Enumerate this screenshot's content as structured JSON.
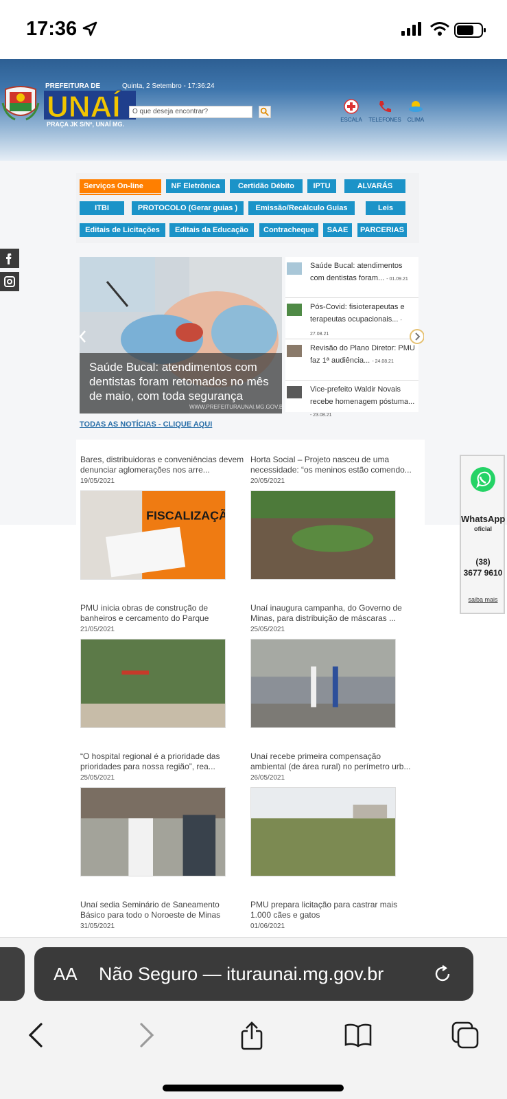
{
  "status_bar": {
    "time": "17:36"
  },
  "header": {
    "logo_prefix": "PREFEITURA DE",
    "logo_name": "UNAÍ",
    "address": "PRAÇA JK S/Nº, UNAÍ MG.",
    "date_line": "Quinta, 2 Setembro - 17:36:24",
    "search_placeholder": "O que deseja encontrar?",
    "tools": [
      {
        "label": "ESCALA",
        "icon": "medical-cross-icon"
      },
      {
        "label": "TELEFONES",
        "icon": "phone-icon"
      },
      {
        "label": "CLIMA",
        "icon": "weather-sun-cloud-icon"
      }
    ]
  },
  "services": [
    "Serviços On-line",
    "NF Eletrônica",
    "Certidão Débito",
    "IPTU",
    "ALVARÁS",
    "ITBI",
    "PROTOCOLO (Gerar guias )",
    "Emissão/Recálculo Guias",
    "Leis",
    "Editais de Licitações",
    "Editais da Educação",
    "Contracheque",
    "SAAE",
    "PARCERIAS"
  ],
  "slider": {
    "caption": "Saúde Bucal: atendimentos com dentistas foram retomados no mês de maio, com toda segurança",
    "watermark": "WWW.PREFEITURAUNAI.MG.GOV.BR"
  },
  "news_list": [
    {
      "title": "Saúde Bucal: atendimentos com dentistas foram...",
      "date": "- 01.09.21"
    },
    {
      "title": "Pós-Covid: fisioterapeutas e terapeutas ocupacionais...",
      "date": "- 27.08.21"
    },
    {
      "title": "Revisão do Plano Diretor: PMU faz 1ª audiência...",
      "date": "- 24.08.21"
    },
    {
      "title": "Vice-prefeito Waldir Novais recebe homenagem póstuma...",
      "date": "- 23.08.21"
    }
  ],
  "all_news_link": "TODAS AS NOTÍCIAS - CLIQUE AQUI",
  "cards": [
    {
      "title": "Bares, distribuidoras e conveniências devem denunciar aglomerações nos arre...",
      "date": "19/05/2021"
    },
    {
      "title": "Horta Social – Projeto nasceu de uma necessidade: “os meninos estão comendo...",
      "date": "20/05/2021"
    },
    {
      "title": "PMU inicia obras de construção de banheiros e cercamento do Parque Dujardes...",
      "date": "21/05/2021"
    },
    {
      "title": "Unaí inaugura campanha, do Governo de Minas, para distribuição de máscaras ...",
      "date": "25/05/2021"
    },
    {
      "title": "“O hospital regional é a prioridade das prioridades para nossa região”, rea...",
      "date": "25/05/2021"
    },
    {
      "title": "Unaí recebe primeira compensação ambiental (de área rural) no perímetro urb...",
      "date": "26/05/2021"
    },
    {
      "title": "Unaí sedia Seminário de Saneamento Básico para todo o Noroeste de Minas",
      "date": "31/05/2021"
    },
    {
      "title": "PMU prepara licitação para castrar mais 1.000 cães e gatos",
      "date": "01/06/2021"
    }
  ],
  "whatsapp": {
    "title": "WhatsApp",
    "subtitle": "oficial",
    "phone_line1": "(38)",
    "phone_line2": "3677 9610",
    "more": "saiba mais"
  },
  "safari": {
    "aa": "AA",
    "url_text": "Não Seguro — ituraunai.mg.gov.br"
  },
  "colors": {
    "service_blue": "#1b93c8",
    "service_active": "#ff7f00",
    "header_blue": "#2d5f93",
    "whatsapp_green": "#25d366"
  }
}
